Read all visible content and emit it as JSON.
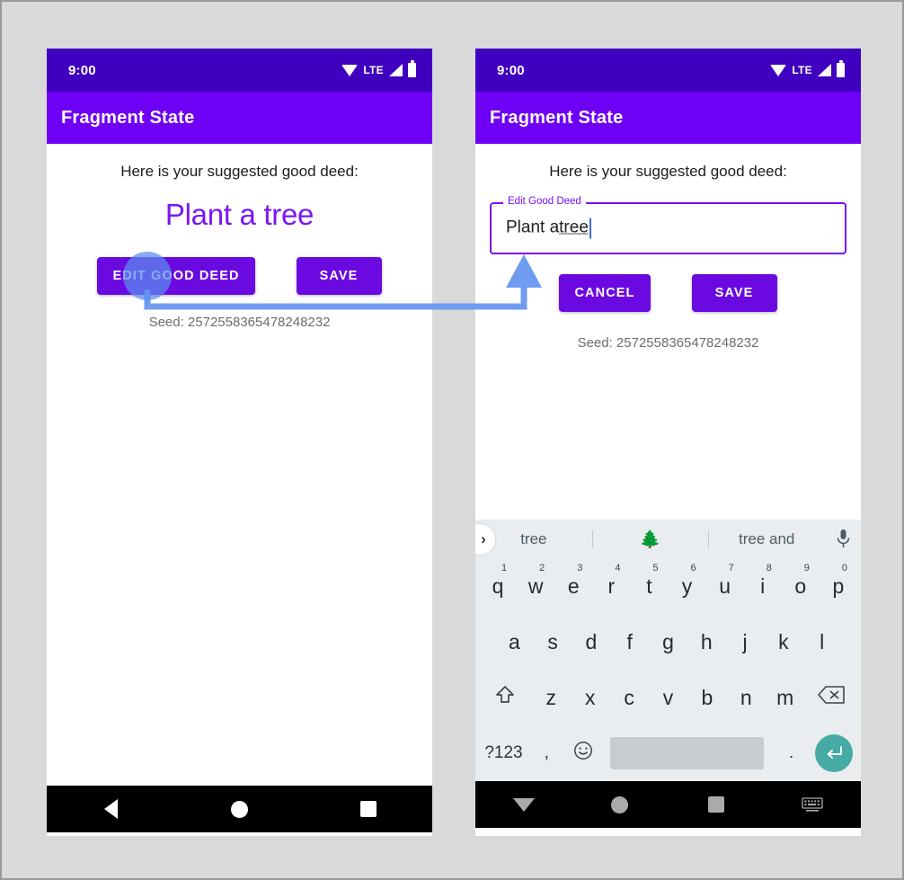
{
  "theme": {
    "status_bar_color": "#4000c0",
    "app_bar_color": "#6e00f5",
    "accent_purple": "#7a0df0",
    "button_purple": "#6a0ae0",
    "annotation_blue": "#6f9cf0",
    "keyboard_bg": "#e9edf0",
    "enter_key_teal": "#45aba4",
    "page_bg": "#d9d9d9"
  },
  "status_bar": {
    "time": "9:00",
    "network_label": "LTE",
    "icons": [
      "wifi-icon",
      "signal-icon",
      "battery-icon"
    ]
  },
  "app_bar": {
    "title": "Fragment State"
  },
  "left_phone": {
    "prompt": "Here is your suggested good deed:",
    "deed": "Plant a tree",
    "buttons": [
      {
        "label": "EDIT GOOD DEED",
        "name": "edit-good-deed-button"
      },
      {
        "label": "SAVE",
        "name": "save-button"
      }
    ],
    "seed": "Seed: 2572558365478248232",
    "nav": [
      "back-icon",
      "home-icon",
      "recents-icon"
    ]
  },
  "right_phone": {
    "prompt": "Here is your suggested good deed:",
    "text_field": {
      "label": "Edit Good Deed",
      "value_prefix": "Plant a ",
      "value_misspelled": "tree",
      "placeholder": "Edit Good Deed"
    },
    "buttons": [
      {
        "label": "CANCEL",
        "name": "cancel-button"
      },
      {
        "label": "SAVE",
        "name": "save-button"
      }
    ],
    "seed": "Seed: 2572558365478248232",
    "nav": [
      "dismiss-keyboard-icon",
      "home-icon",
      "recents-icon",
      "keyboard-switch-icon"
    ]
  },
  "keyboard": {
    "suggestions": [
      {
        "text": "tree",
        "name": "suggestion-tree"
      },
      {
        "text": "🌲",
        "name": "suggestion-tree-emoji"
      },
      {
        "text": "tree and",
        "name": "suggestion-tree-and"
      }
    ],
    "expand_icon": "chevron-right-icon",
    "mic_icon": "microphone-icon",
    "row1": [
      {
        "key": "q",
        "num": "1"
      },
      {
        "key": "w",
        "num": "2"
      },
      {
        "key": "e",
        "num": "3"
      },
      {
        "key": "r",
        "num": "4"
      },
      {
        "key": "t",
        "num": "5"
      },
      {
        "key": "y",
        "num": "6"
      },
      {
        "key": "u",
        "num": "7"
      },
      {
        "key": "i",
        "num": "8"
      },
      {
        "key": "o",
        "num": "9"
      },
      {
        "key": "p",
        "num": "0"
      }
    ],
    "row2": [
      "a",
      "s",
      "d",
      "f",
      "g",
      "h",
      "j",
      "k",
      "l"
    ],
    "row3": [
      "z",
      "x",
      "c",
      "v",
      "b",
      "n",
      "m"
    ],
    "shift_label": "shift-icon",
    "backspace_label": "backspace-icon",
    "row4": {
      "symbols_label": "?123",
      "comma_label": ",",
      "emoji_label": "☺",
      "space_label": "",
      "period_label": ".",
      "enter_label": "enter-icon"
    }
  },
  "annotation": {
    "description": "Tap on EDIT GOOD DEED leads to the Edit Good Deed text field",
    "touch_point_label": "touch-indicator"
  }
}
